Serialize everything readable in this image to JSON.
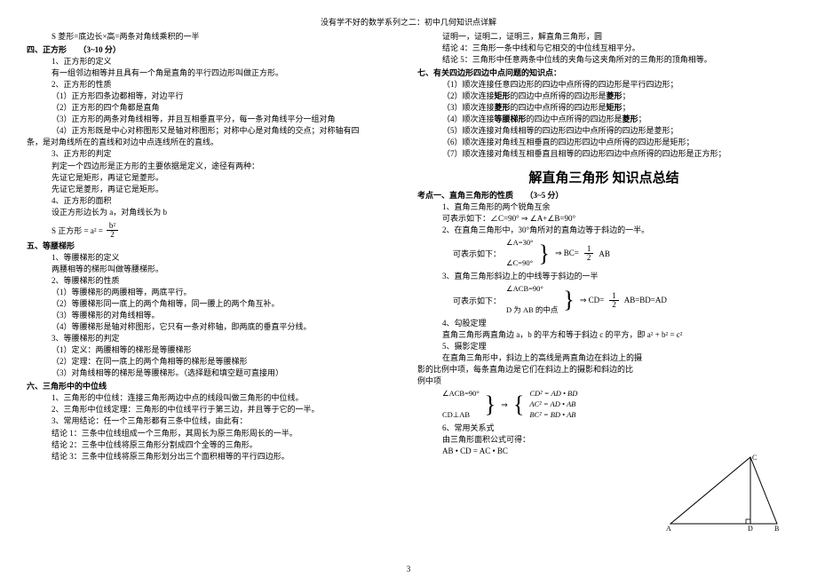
{
  "header": "没有学不好的数学系列之二：初中几何知识点详解",
  "pageNum": "3",
  "left": {
    "l0": "S 菱形=底边长×高=两条对角线乘积的一半",
    "sec4": "四、正方形　　（3~10 分）",
    "s4_1": "1、正方形的定义",
    "s4_1a": "有一组邻边相等并且具有一个角是直角的平行四边形叫做正方形。",
    "s4_2": "2、正方形的性质",
    "s4_2a": "（1）正方形四条边都相等，对边平行",
    "s4_2b": "（2）正方形的四个角都是直角",
    "s4_2c": "（3）正方形的两条对角线相等，并且互相垂直平分，每一条对角线平分一组对角",
    "s4_2d": "（4）正方形既是中心对称图形又是轴对称图形；对称中心是对角线的交点；对称轴有四",
    "s4_2e": "条，是对角线所在的直线和对边中点连线所在的直线。",
    "s4_3": "3、正方形的判定",
    "s4_3a": "判定一个四边形是正方形的主要依据是定义，途径有两种：",
    "s4_3b": "先证它是矩形，再证它是菱形。",
    "s4_3c": "先证它是菱形，再证它是矩形。",
    "s4_4": "4、正方形的面积",
    "s4_4a": "设正方形边长为 a，对角线长为 b",
    "f_label": "S 正方形 = a² =",
    "f_num": "b²",
    "f_den": "2",
    "sec5": "五、等腰梯形",
    "s5_1": "1、等腰梯形的定义",
    "s5_1a": "两腰相等的梯形叫做等腰梯形。",
    "s5_2": "2、等腰梯形的性质",
    "s5_2a": "（1）等腰梯形的两腰相等，两底平行。",
    "s5_2b": "（2）等腰梯形同一底上的两个角相等，同一腰上的两个角互补。",
    "s5_2c": "（3）等腰梯形的对角线相等。",
    "s5_2d": "（4）等腰梯形是轴对称图形，它只有一条对称轴，即两底的垂直平分线。",
    "s5_3": "3、等腰梯形的判定",
    "s5_3a": "（1）定义：两腰相等的梯形是等腰梯形",
    "s5_3b": "（2）定理：在同一底上的两个角相等的梯形是等腰梯形",
    "s5_3c": "（3）对角线相等的梯形是等腰梯形。（选择题和填空题可直接用）",
    "sec6": "六、三角形中的中位线",
    "s6_1": "1、三角形的中位线：连接三角形两边中点的线段叫做三角形的中位线。",
    "s6_2": "2、三角形中位线定理：三角形的中位线平行于第三边，并且等于它的一半。",
    "s6_3": "3、常用结论：任一个三角形都有三条中位线，由此有：",
    "s6_3a": "结论 1：三条中位线组成一个三角形，其周长为原三角形周长的一半。",
    "s6_3b": "结论 2：三条中位线将原三角形分割成四个全等的三角形。",
    "s6_3c": "结论 3：三条中位线将原三角形划分出三个面积相等的平行四边形。"
  },
  "right": {
    "r0": "证明一，证明二，证明三，解直角三角形，圆",
    "r1": "结论 4：三角形一条中线和与它相交的中位线互相平分。",
    "r2": "结论 5：三角形中任意两条中位线的夹角与这夹角所对的三角形的顶角相等。",
    "sec7": "七、有关四边形四边中点问题的知识点：",
    "s7_1": "（1）顺次连接任意四边形的四边中点所得的四边形是平行四边形；",
    "s7_2a": "（2）顺次连接",
    "s7_2b": "矩形",
    "s7_2c": "的四边中点所得的四边形是",
    "s7_2d": "菱形",
    "s7_2e": "；",
    "s7_3a": "（3）顺次连接",
    "s7_3b": "菱形",
    "s7_3c": "的四边中点所得的四边形是",
    "s7_3d": "矩形",
    "s7_3e": "；",
    "s7_4a": "（4）顺次连接",
    "s7_4b": "等腰梯形",
    "s7_4c": "的四边中点所得的四边形是",
    "s7_4d": "菱形",
    "s7_4e": "；",
    "s7_5": "（5）顺次连接对角线相等的四边形四边中点所得的四边形是菱形；",
    "s7_6": "（6）顺次连接对角线互相垂直的四边形四边中点所得的四边形是矩形；",
    "s7_7": "（7）顺次连接对角线互相垂直且相等的四边形四边中点所得的四边形是正方形；",
    "title": "解直角三角形  知识点总结",
    "k1": "考点一、直角三角形的性质　　（3~5 分）",
    "k1_1": "1、直角三角形的两个锐角互余",
    "k1_1a": "可表示如下：∠C=90° ⇒ ∠A+∠B=90°",
    "k1_2": "2、在直角三角形中，30°角所对的直角边等于斜边的一半。",
    "k1_2a": "∠A=30°",
    "k1_2b": "可表示如下：",
    "k1_2c": "∠C=90°",
    "k1_2r": "⇒ BC=",
    "k1_2rn": "1",
    "k1_2rd": "2",
    "k1_2rs": "AB",
    "k1_3": "3、直角三角形斜边上的中线等于斜边的一半",
    "k1_3a": "∠ACB=90°",
    "k1_3b": "可表示如下：",
    "k1_3c": "D 为 AB 的中点",
    "k1_3r": "⇒ CD=",
    "k1_3rn": "1",
    "k1_3rd": "2",
    "k1_3rs": "AB=BD=AD",
    "k1_4": "4、勾股定理",
    "k1_4a": "直角三角形两直角边 a，b 的平方和等于斜边 c 的平方，即 a² + b² = c²",
    "k1_5": "5、摄影定理",
    "k1_5a": "在直角三角形中，斜边上的高线是两直角边在斜边上的摄",
    "k1_5b": "影的比例中项，每条直角边是它们在斜边上的摄影和斜边的比",
    "k1_5c": "例中项",
    "k1_5d": "∠ACB=90°",
    "k1_5e": "CD⊥AB",
    "k1_5r1": "CD² = AD • BD",
    "k1_5r2": "AC² = AD • AB",
    "k1_5r3": "BC² = BD • AB",
    "k1_6": "6、常用关系式",
    "k1_6a": "由三角形面积公式可得：",
    "k1_6b": "AB • CD = AC • BC",
    "triA": "A",
    "triB": "B",
    "triC": "C",
    "triD": "D"
  }
}
